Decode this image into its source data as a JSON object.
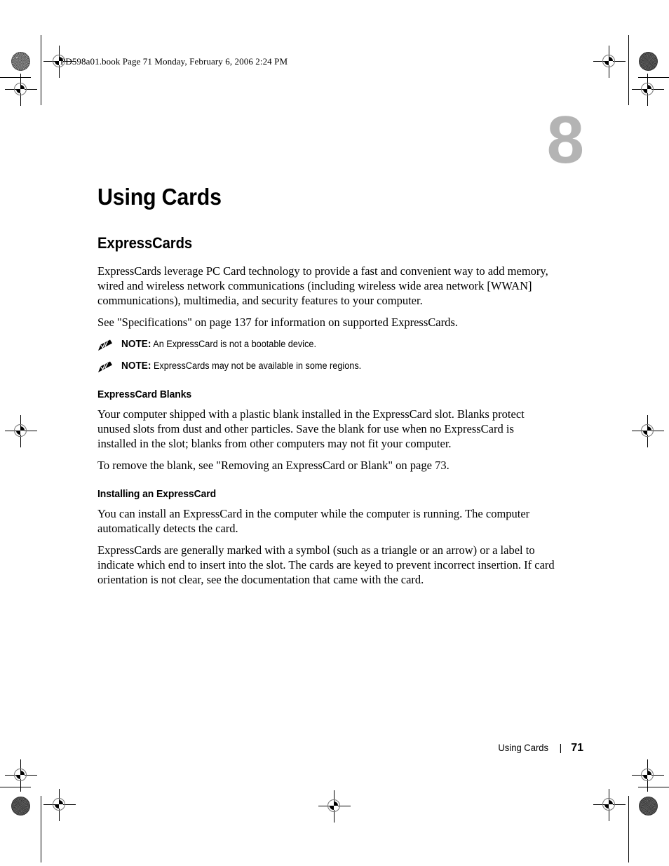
{
  "header": {
    "file_info": "PD598a01.book  Page 71  Monday, February 6, 2006  2:24 PM"
  },
  "chapter": {
    "number": "8"
  },
  "page": {
    "title": "Using Cards",
    "section_heading": "ExpressCards",
    "intro_paragraph": "ExpressCards leverage PC Card technology to provide a fast and convenient way to add memory, wired and wireless network communications (including wireless wide area network [WWAN] communications), multimedia, and security features to your computer.",
    "spec_reference": "See \"Specifications\" on page 137 for information on supported ExpressCards.",
    "notes": [
      {
        "label": "NOTE:",
        "text": "An ExpressCard is not a bootable device.",
        "icon": "note-pencil-icon"
      },
      {
        "label": "NOTE:",
        "text": "ExpressCards may not be available in some regions.",
        "icon": "note-pencil-icon"
      }
    ],
    "subsections": [
      {
        "heading": "ExpressCard Blanks",
        "paragraphs": [
          "Your computer shipped with a plastic blank installed in the ExpressCard slot. Blanks protect unused slots from dust and other particles. Save the blank for use when no ExpressCard is installed in the slot; blanks from other computers may not fit your computer.",
          "To remove the blank, see \"Removing an ExpressCard or Blank\" on page 73."
        ]
      },
      {
        "heading": "Installing an ExpressCard",
        "paragraphs": [
          "You can install an ExpressCard in the computer while the computer is running. The computer automatically detects the card.",
          "ExpressCards are generally marked with a symbol (such as a triangle or an arrow) or a label to indicate which end to insert into the slot. The cards are keyed to prevent incorrect insertion. If card orientation is not clear, see the documentation that came with the card."
        ]
      }
    ]
  },
  "footer": {
    "title": "Using Cards",
    "separator": "|",
    "page_number": "71"
  },
  "colors": {
    "chapter_number_gray": "#b4b4b4",
    "text_black": "#000000",
    "page_background": "#ffffff",
    "registration_ring": "#777777"
  }
}
